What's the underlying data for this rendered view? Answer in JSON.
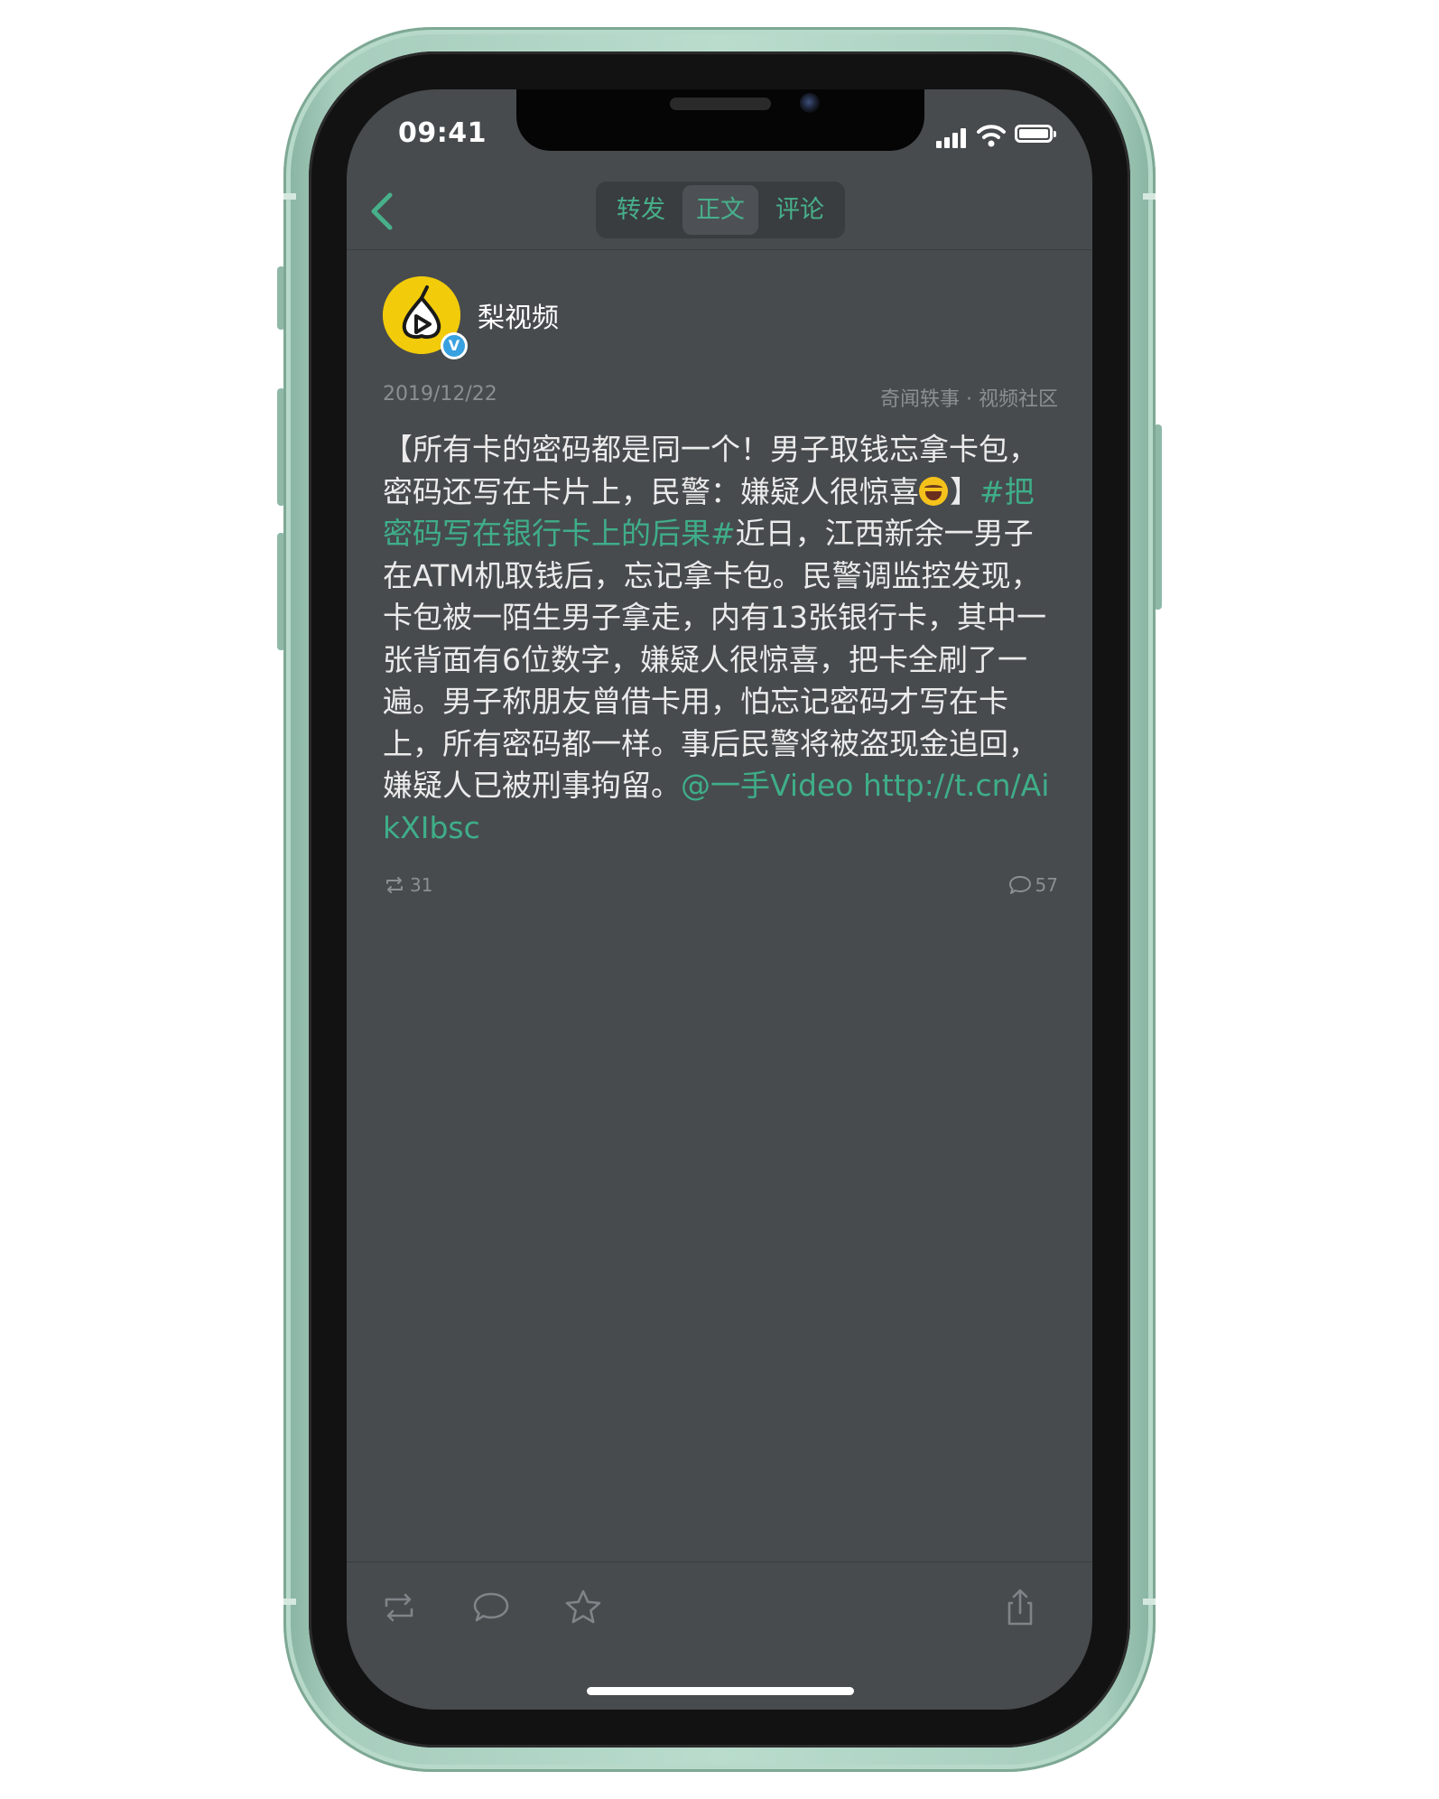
{
  "status_bar": {
    "time": "09:41"
  },
  "nav": {
    "tabs": [
      {
        "label": "转发",
        "active": false
      },
      {
        "label": "正文",
        "active": true
      },
      {
        "label": "评论",
        "active": false
      }
    ]
  },
  "post": {
    "author": {
      "name": "梨视频",
      "verified_badge": "V"
    },
    "date": "2019/12/22",
    "source": "奇闻轶事 · 视频社区",
    "body": {
      "part1": "【所有卡的密码都是同一个！男子取钱忘拿卡包，密码还写在卡片上，民警：嫌疑人很惊喜",
      "part2": "】",
      "hashtag": "#把密码写在银行卡上的后果#",
      "part3": "近日，江西新余一男子在ATM机取钱后，忘记拿卡包。民警调监控发现，卡包被一陌生男子拿走，内有13张银行卡，其中一张背面有6位数字，嫌疑人很惊喜，把卡全刷了一遍。男子称朋友曾借卡用，怕忘记密码才写在卡上，所有密码都一样。事后民警将被盗现金追回，嫌疑人已被刑事拘留。",
      "mention": "@一手Video",
      "space": " ",
      "url": "http://t.cn/AikXIbsc"
    },
    "reposts": "31",
    "comments": "57"
  },
  "toolbar": {
    "icons": [
      "repost-icon",
      "comment-icon",
      "star-icon",
      "share-icon"
    ]
  },
  "colors": {
    "accent": "#47b08a",
    "screen_bg": "#474b4e",
    "frame": "#b9dccd"
  }
}
